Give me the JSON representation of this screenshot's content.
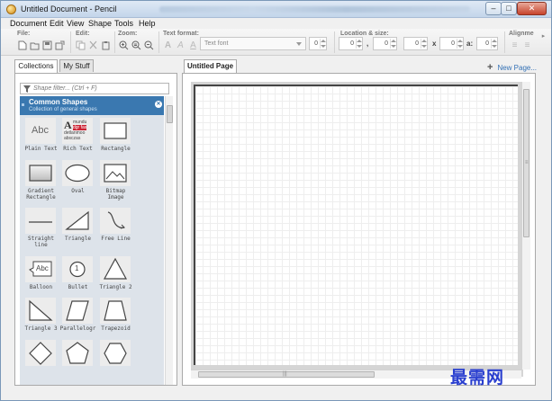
{
  "window": {
    "title": "Untitled Document - Pencil",
    "controls": [
      "–",
      "□",
      "✕"
    ]
  },
  "menu": [
    "Document",
    "Edit",
    "View",
    "Shape",
    "Tools",
    "Help"
  ],
  "toolbar": {
    "sections": [
      "File:",
      "Edit:",
      "Zoom:",
      "Text format:",
      "Location & size:",
      "Alignme"
    ],
    "file_icons": [
      "new-document-icon",
      "open-folder-icon",
      "save-icon",
      "export-icon"
    ],
    "edit_icons": [
      "copy-icon",
      "cut-icon",
      "paste-icon"
    ],
    "zoom_icons": [
      "zoom-in-icon",
      "zoom-reset-icon",
      "zoom-out-icon"
    ],
    "text_icons": [
      "text-bold-icon",
      "text-italic-icon",
      "text-underline-icon"
    ],
    "font_placeholder": "Text font",
    "font_size": "0",
    "x": "0",
    "y": "0",
    "width": "0",
    "height": "0",
    "angle": "0",
    "x_sep": ",",
    "wh_sep": "x",
    "angle_sep": "a:"
  },
  "left_panel": {
    "tabs": [
      "Collections",
      "My Stuff"
    ],
    "filter_placeholder": "Shape filter... (Ctrl + F)",
    "collection": {
      "title": "Common Shapes",
      "subtitle": "Collection of general shapes"
    },
    "shapes": [
      {
        "name": "plain-text",
        "label": "Plain Text",
        "preview_text": "Abc"
      },
      {
        "name": "rich-text",
        "label": "Rich Text",
        "preview_text": "A",
        "preview_lines": [
          "mundu",
          "dgr fas",
          "detlanmoo",
          "absczas"
        ]
      },
      {
        "name": "rectangle",
        "label": "Rectangle"
      },
      {
        "name": "gradient-rectangle",
        "label": "Gradient\nRectangle"
      },
      {
        "name": "oval",
        "label": "Oval"
      },
      {
        "name": "bitmap-image",
        "label": "Bitmap\nImage"
      },
      {
        "name": "straight-line",
        "label": "Straight\nline"
      },
      {
        "name": "triangle",
        "label": "Triangle"
      },
      {
        "name": "free-line",
        "label": "Free Line"
      },
      {
        "name": "balloon",
        "label": "Balloon",
        "preview_text": "Abc"
      },
      {
        "name": "bullet",
        "label": "Bullet",
        "preview_text": "1"
      },
      {
        "name": "triangle-2",
        "label": "Triangle 2"
      },
      {
        "name": "triangle-3",
        "label": "Triangle 3"
      },
      {
        "name": "parallelogram",
        "label": "Parallelogr"
      },
      {
        "name": "trapezoid",
        "label": "Trapezoid"
      },
      {
        "name": "diamond",
        "label": ""
      },
      {
        "name": "pentagon",
        "label": ""
      },
      {
        "name": "hexagon",
        "label": ""
      }
    ]
  },
  "right_panel": {
    "page_tab": "Untitled Page",
    "new_page": "New Page..."
  },
  "watermark": "最需网"
}
